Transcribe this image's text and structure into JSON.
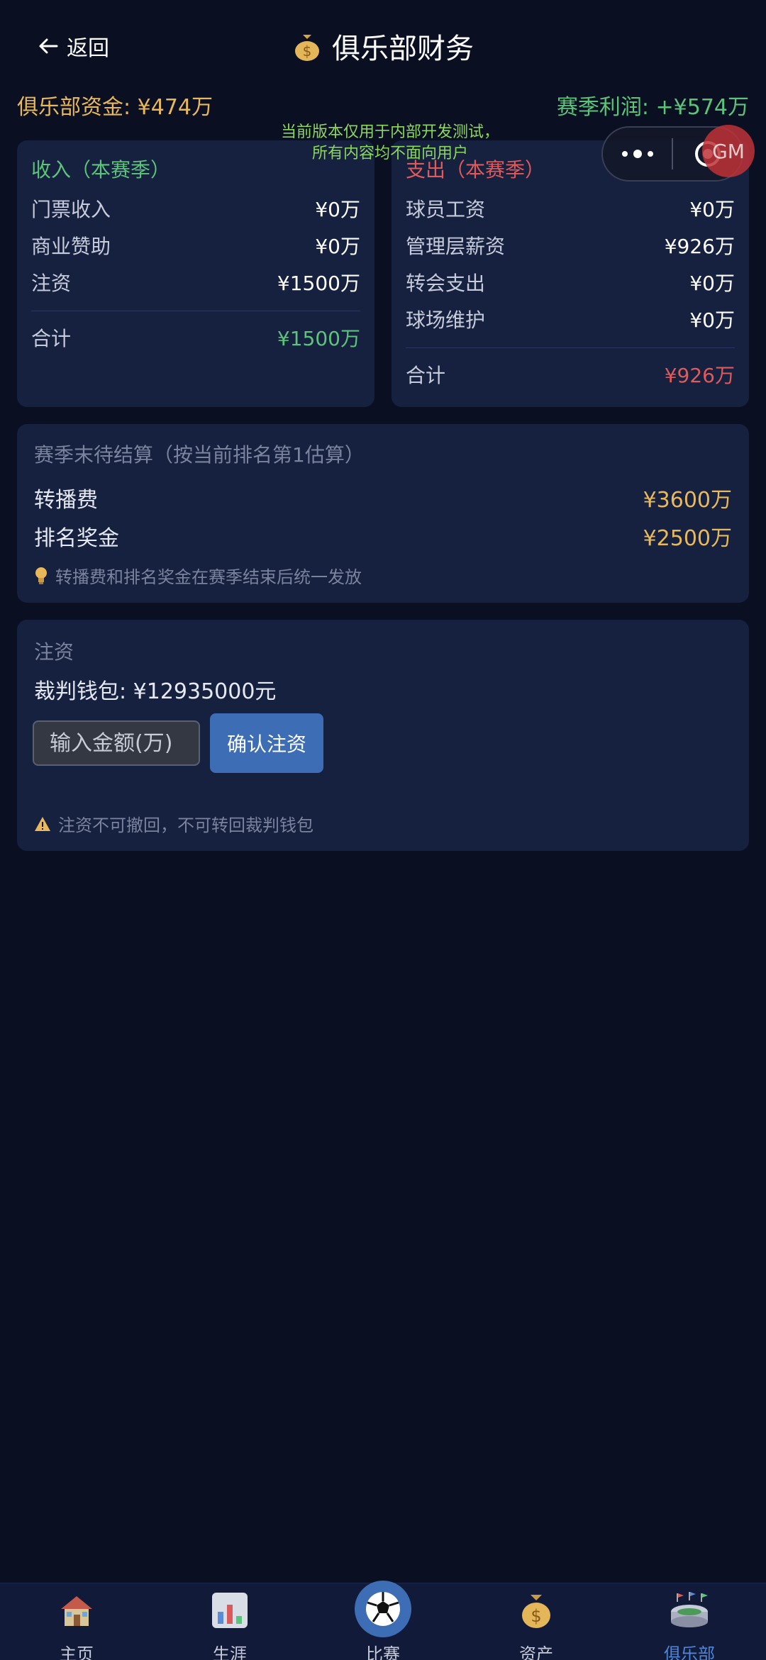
{
  "header": {
    "back_label": "返回",
    "title": "俱乐部财务"
  },
  "summary": {
    "funds": "俱乐部资金: ¥474万",
    "profit": "赛季利润: +¥574万"
  },
  "dev_notice": {
    "line1": "当前版本仅用于内部开发测试，",
    "line2": "所有内容均不面向用户"
  },
  "gm_badge": "GM",
  "income": {
    "title": "收入（本赛季）",
    "rows": [
      {
        "label": "门票收入",
        "value": "¥0万"
      },
      {
        "label": "商业赞助",
        "value": "¥0万"
      },
      {
        "label": "注资",
        "value": "¥1500万"
      }
    ],
    "total_label": "合计",
    "total_value": "¥1500万"
  },
  "expense": {
    "title": "支出（本赛季）",
    "rows": [
      {
        "label": "球员工资",
        "value": "¥0万"
      },
      {
        "label": "管理层薪资",
        "value": "¥926万"
      },
      {
        "label": "转会支出",
        "value": "¥0万"
      },
      {
        "label": "球场维护",
        "value": "¥0万"
      }
    ],
    "total_label": "合计",
    "total_value": "¥926万"
  },
  "settlement": {
    "title": "赛季末待结算（按当前排名第1估算）",
    "rows": [
      {
        "label": "转播费",
        "value": "¥3600万"
      },
      {
        "label": "排名奖金",
        "value": "¥2500万"
      }
    ],
    "tip": "转播费和排名奖金在赛季结束后统一发放"
  },
  "investment": {
    "title": "注资",
    "wallet": "裁判钱包: ¥12935000元",
    "input_placeholder": "输入金额(万)",
    "confirm_label": "确认注资",
    "warning": "注资不可撤回，不可转回裁判钱包"
  },
  "tabs": [
    {
      "label": "主页",
      "icon": "house-icon"
    },
    {
      "label": "生涯",
      "icon": "bar-chart-icon"
    },
    {
      "label": "比赛",
      "icon": "soccer-ball-icon"
    },
    {
      "label": "资产",
      "icon": "money-bag-icon"
    },
    {
      "label": "俱乐部",
      "icon": "stadium-icon",
      "active": true
    }
  ],
  "colors": {
    "background": "#0a0f22",
    "card": "#16203f",
    "income_green": "#5cc47a",
    "expense_red": "#e05a5a",
    "gold": "#e8b85a",
    "accent_blue": "#3d6db5"
  }
}
